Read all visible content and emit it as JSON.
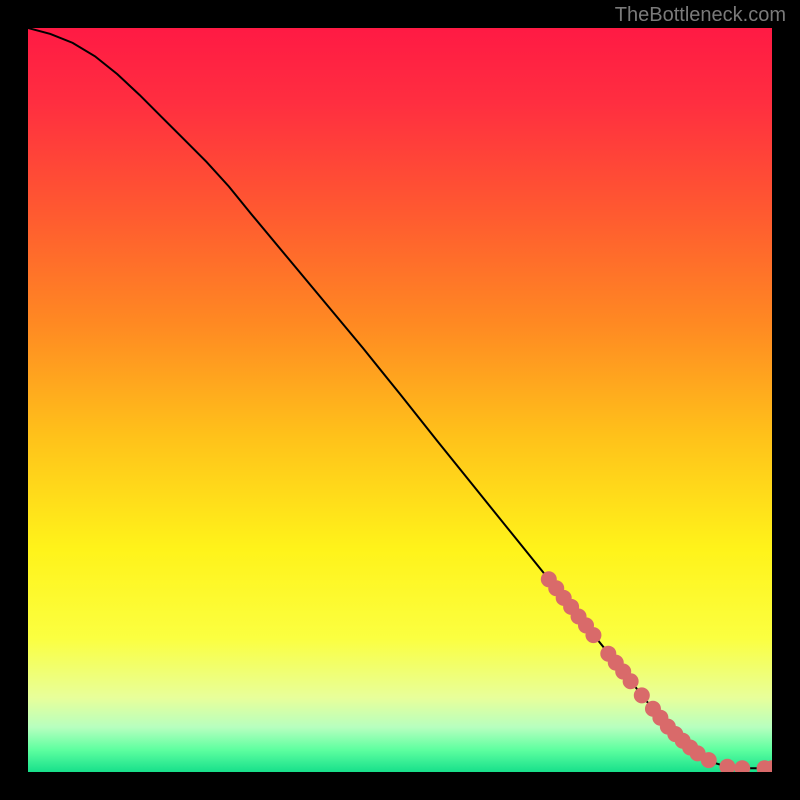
{
  "attribution": "TheBottleneck.com",
  "chart_data": {
    "type": "line",
    "title": "",
    "xlabel": "",
    "ylabel": "",
    "xlim": [
      0,
      100
    ],
    "ylim": [
      0,
      100
    ],
    "curve": {
      "x": [
        0,
        3,
        6,
        9,
        12,
        15,
        18,
        21,
        24,
        27,
        30,
        35,
        40,
        45,
        50,
        55,
        60,
        65,
        70,
        75,
        80,
        83,
        85,
        88,
        90,
        92,
        94,
        96,
        98,
        100
      ],
      "y": [
        100,
        99.2,
        98,
        96.2,
        93.8,
        91,
        88,
        85,
        82,
        78.7,
        75,
        69,
        63,
        57,
        50.8,
        44.5,
        38.3,
        32.1,
        25.9,
        19.7,
        13.5,
        9.7,
        7.3,
        4.2,
        2.5,
        1.3,
        0.7,
        0.5,
        0.5,
        0.5
      ]
    },
    "markers": {
      "x": [
        70,
        71,
        72,
        73,
        74,
        75,
        76,
        78,
        79,
        80,
        81,
        82.5,
        84,
        85,
        86,
        87,
        88,
        89,
        90,
        91.5,
        94,
        96,
        99,
        100
      ],
      "y": [
        25.9,
        24.7,
        23.4,
        22.2,
        20.9,
        19.7,
        18.4,
        15.9,
        14.7,
        13.5,
        12.2,
        10.3,
        8.5,
        7.3,
        6.1,
        5.1,
        4.2,
        3.3,
        2.5,
        1.6,
        0.7,
        0.5,
        0.5,
        0.5
      ],
      "color": "#d96a6a"
    },
    "gradient_stops": [
      {
        "offset": 0.0,
        "color": "#ff1a44"
      },
      {
        "offset": 0.1,
        "color": "#ff2e40"
      },
      {
        "offset": 0.25,
        "color": "#ff5a30"
      },
      {
        "offset": 0.4,
        "color": "#ff8a22"
      },
      {
        "offset": 0.55,
        "color": "#ffc21a"
      },
      {
        "offset": 0.7,
        "color": "#fff31a"
      },
      {
        "offset": 0.82,
        "color": "#fbff40"
      },
      {
        "offset": 0.9,
        "color": "#e8ff9a"
      },
      {
        "offset": 0.94,
        "color": "#b7ffbf"
      },
      {
        "offset": 0.97,
        "color": "#5effa0"
      },
      {
        "offset": 1.0,
        "color": "#17e08b"
      }
    ]
  }
}
